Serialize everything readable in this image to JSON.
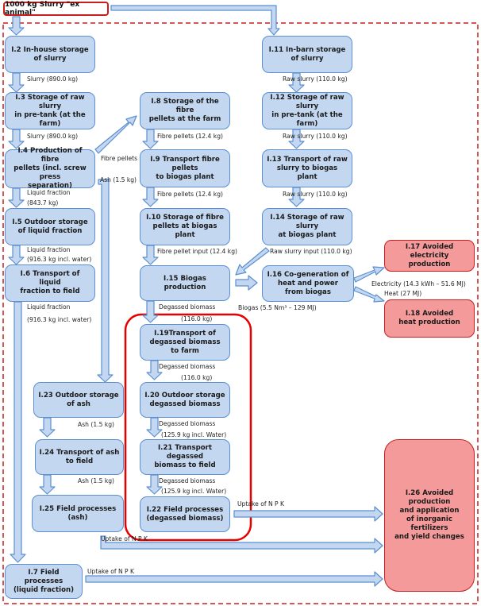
{
  "source": {
    "label": "1000 kg Slurry \"ex animal\""
  },
  "colors": {
    "process_fill": "#c3d7f0",
    "process_border": "#5b8fd0",
    "avoided_fill": "#f59a9a",
    "avoided_border": "#c81e1e",
    "system_boundary": "#c81e1e",
    "highlight": "#e60000",
    "arrow_fill": "#c3d7f0",
    "arrow_stroke": "#5b8fd0"
  },
  "nodes": {
    "n1_2": "I.2 In-house storage\nof slurry",
    "n1_3": "I.3 Storage of raw slurry\nin pre-tank (at the farm)",
    "n1_4": "I.4 Production of fibre\npellets (incl. screw press\nseparation)",
    "n1_5": "I.5 Outdoor storage\nof liquid fraction",
    "n1_6": "I.6 Transport of liquid\nfraction to field",
    "n1_7": "I.7 Field processes\n(liquid fraction)",
    "n1_8": "I.8 Storage of the fibre\npellets at the farm",
    "n1_9": "I.9 Transport fibre pellets\nto biogas plant",
    "n1_10": "I.10 Storage of fibre\npellets at biogas plant",
    "n1_11": "I.11 In-barn storage\nof slurry",
    "n1_12": "I.12 Storage of raw slurry\nin pre-tank (at the farm)",
    "n1_13": "I.13 Transport of raw\nslurry to biogas plant",
    "n1_14": "I.14 Storage of raw slurry\nat biogas plant",
    "n1_15": "I.15 Biogas production",
    "n1_16": "I.16 Co-generation of\nheat and power\nfrom biogas",
    "n1_17": "I.17 Avoided\nelectricity production",
    "n1_18": "I.18 Avoided\nheat production",
    "n1_19": "I.19Transport of\ndegassed biomass\nto farm",
    "n1_20": "I.20 Outdoor storage\ndegassed biomass",
    "n1_21": "I.21 Transport degassed\nbiomass to field",
    "n1_22": "I.22 Field processes\n(degassed biomass)",
    "n1_23": "I.23 Outdoor storage\nof ash",
    "n1_24": "I.24 Transport of ash\nto field",
    "n1_25": "I.25 Field processes\n(ash)",
    "n1_26": "I.26 Avoided\nproduction\nand application\nof inorganic fertilizers\nand yield changes"
  },
  "flows": {
    "slurry_1": "Slurry (890.0 kg)",
    "slurry_2": "Slurry (890.0 kg)",
    "liquid_1a": "Liquid fraction",
    "liquid_1b": "(843.7 kg)",
    "liquid_2a": "Liquid fraction",
    "liquid_2b": "(916.3 kg incl. water)",
    "liquid_3a": "Liquid fraction",
    "liquid_3b": "(916.3 kg incl. water)",
    "fibre_out": "Fibre pellets",
    "ash_out": "Ash (1.5 kg)",
    "fibre_1": "Fibre pellets (12.4 kg)",
    "fibre_2": "Fibre pellets (12.4 kg)",
    "fibre_input": "Fibre pellet input (12.4 kg)",
    "raw_1": "Raw slurry (110.0 kg)",
    "raw_2": "Raw slurry (110.0 kg)",
    "raw_3": "Raw slurry (110.0 kg)",
    "raw_input": "Raw slurry input (110.0 kg)",
    "biogas": "Biogas (5.5 Nm³ – 129 MJ)",
    "electricity": "Electricity (14.3 kWh – 51.6 MJ)",
    "heat": "Heat (27 MJ)",
    "degassed_1a": "Degassed biomass",
    "degassed_1b": "(116.0 kg)",
    "degassed_2a": "Degassed biomass",
    "degassed_2b": "(116.0 kg)",
    "degassed_3a": "Degassed biomass",
    "degassed_3b": "(125.9 kg incl. Water)",
    "degassed_4a": "Degassed biomass",
    "degassed_4b": "(125.9 kg incl. Water)",
    "ash_1": "Ash (1.5 kg)",
    "ash_2": "Ash (1.5 kg)",
    "uptake_22": "Uptake of N P K",
    "uptake_25": "Uptake of N P K",
    "uptake_7": "Uptake of N P K"
  }
}
